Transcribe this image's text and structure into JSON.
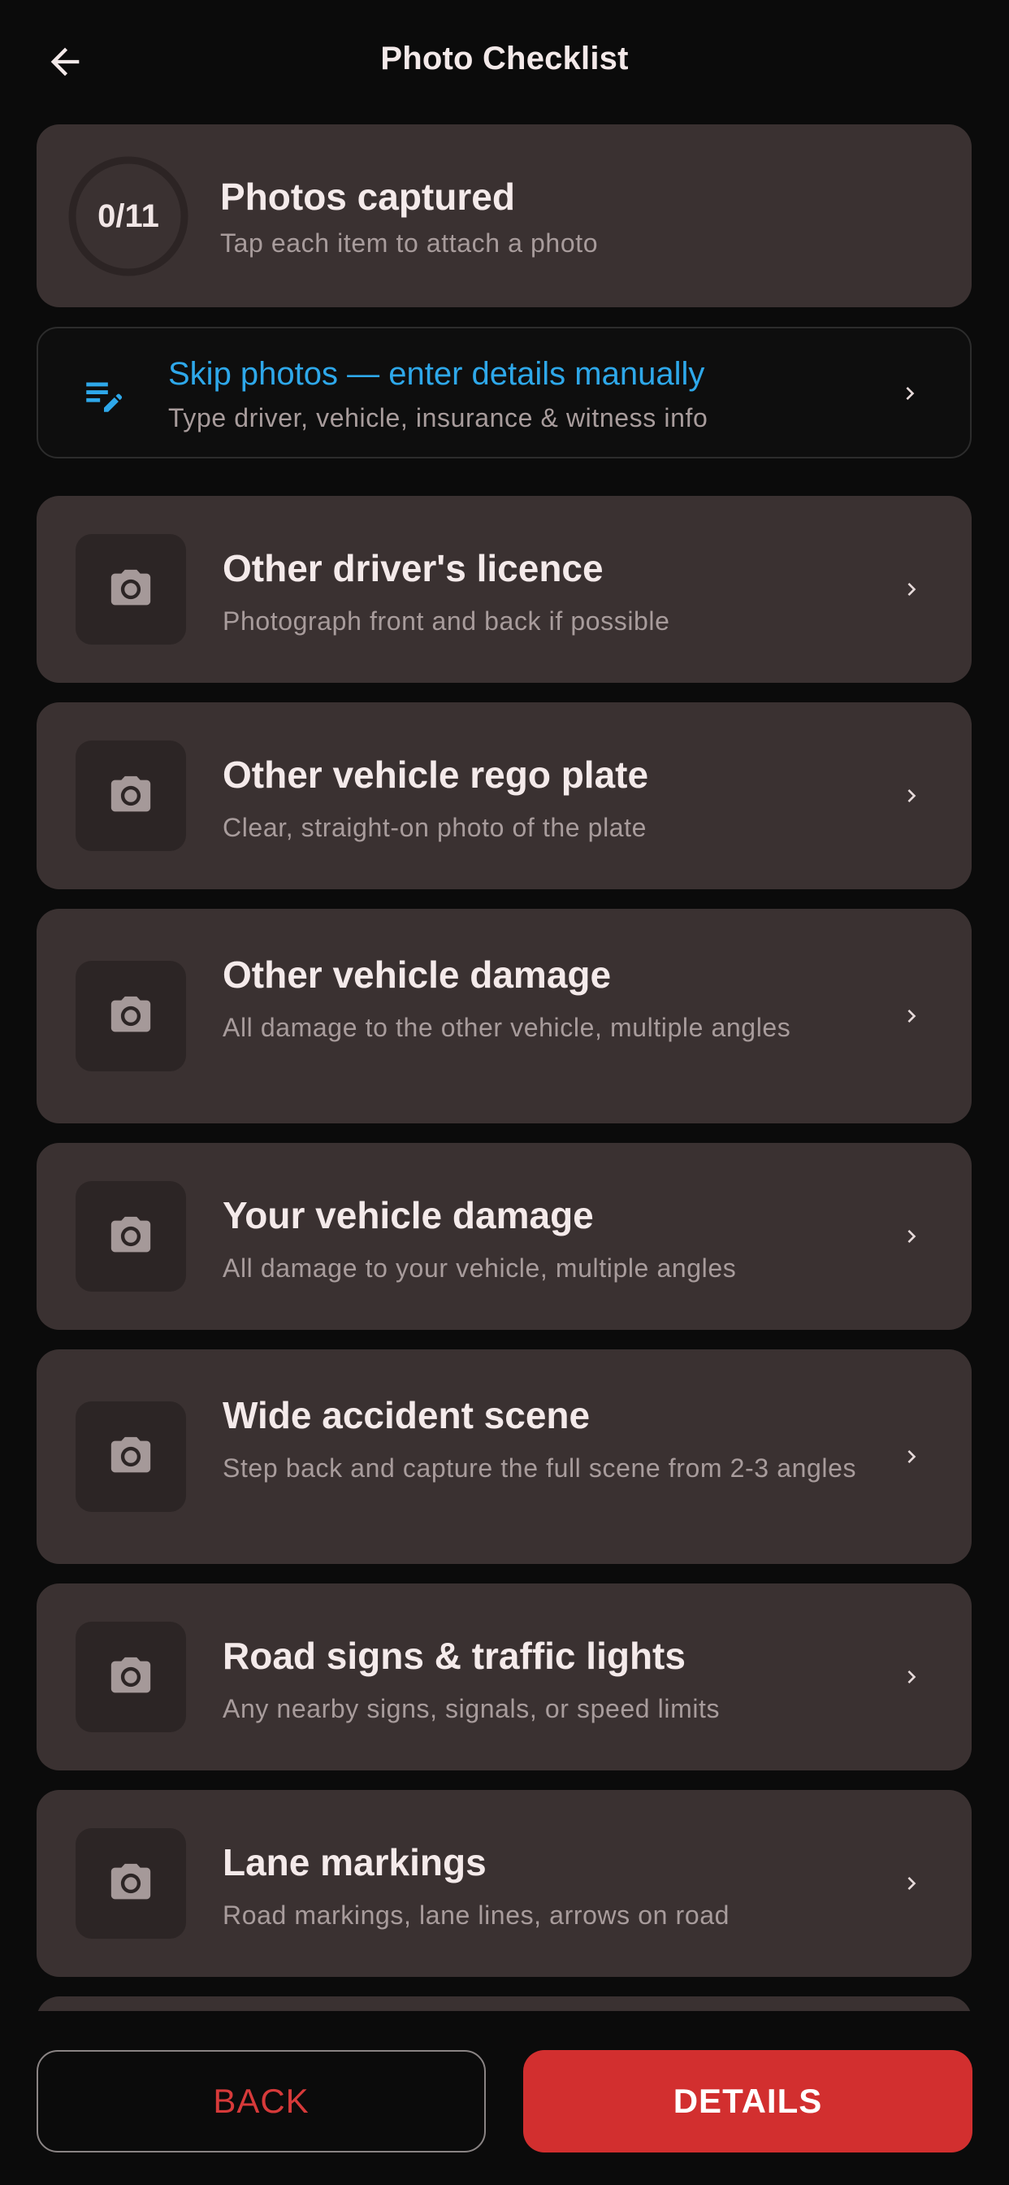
{
  "header": {
    "title": "Photo Checklist",
    "back_icon": "arrow-left-icon"
  },
  "progress": {
    "counter": "0/11",
    "captured": 0,
    "total": 11,
    "title": "Photos captured",
    "subtitle": "Tap each item to attach a photo"
  },
  "skip": {
    "icon": "edit-notes-icon",
    "title": "Skip photos — enter details manually",
    "subtitle": "Type driver, vehicle, insurance & witness info",
    "accent": "#2ea8ea"
  },
  "items": [
    {
      "title": "Other driver's licence",
      "subtitle": "Photograph front and back if possible"
    },
    {
      "title": "Other vehicle rego plate",
      "subtitle": "Clear, straight-on photo of the plate"
    },
    {
      "title": "Other vehicle damage",
      "subtitle": "All damage to the other vehicle, multiple angles"
    },
    {
      "title": "Your vehicle damage",
      "subtitle": "All damage to your vehicle, multiple angles"
    },
    {
      "title": "Wide accident scene",
      "subtitle": "Step back and capture the full scene from 2-3 angles"
    },
    {
      "title": "Road signs & traffic lights",
      "subtitle": "Any nearby signs, signals, or speed limits"
    },
    {
      "title": "Lane markings",
      "subtitle": "Road markings, lane lines, arrows on road"
    }
  ],
  "footer": {
    "back_label": "BACK",
    "details_label": "DETAILS"
  },
  "colors": {
    "background": "#0b0b0b",
    "card": "#3a3131",
    "primary": "#d22f2f",
    "muted_text": "#a89c9c"
  }
}
